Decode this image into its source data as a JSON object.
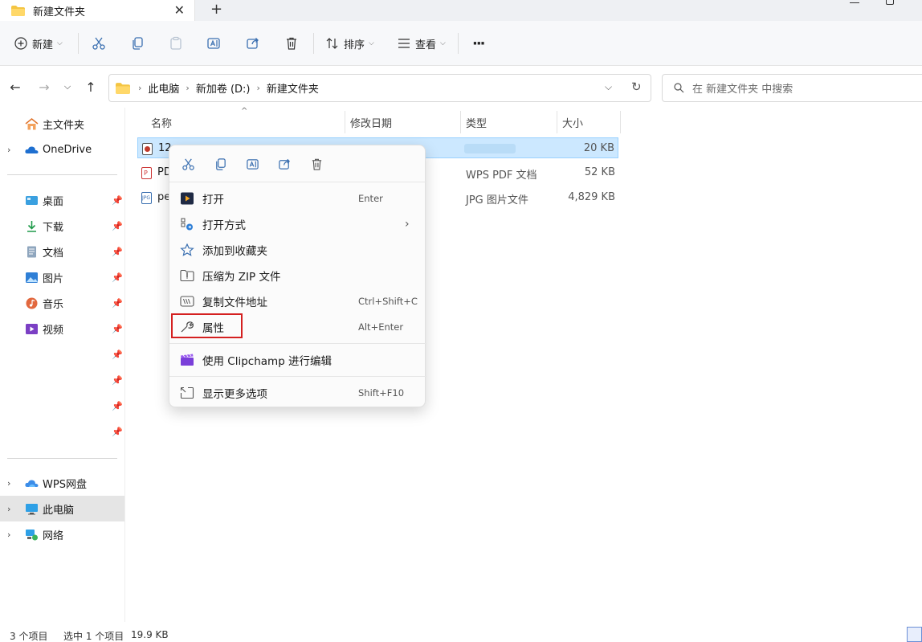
{
  "tab": {
    "title": "新建文件夹",
    "close_glyph": "✕",
    "new_glyph": "+"
  },
  "toolbar": {
    "new_label": "新建",
    "sort_label": "排序",
    "view_label": "查看",
    "more_glyph": "···"
  },
  "address": {
    "crumbs": [
      "此电脑",
      "新加卷 (D:)",
      "新建文件夹"
    ],
    "sep_glyph": "›"
  },
  "search": {
    "placeholder": "在 新建文件夹 中搜索"
  },
  "sidebar": {
    "home": "主文件夹",
    "onedrive": "OneDrive",
    "quick": [
      "桌面",
      "下载",
      "文档",
      "图片",
      "音乐",
      "视频"
    ],
    "wps": "WPS网盘",
    "pc": "此电脑",
    "network": "网络"
  },
  "columns": {
    "name": "名称",
    "modified": "修改日期",
    "type": "类型",
    "size": "大小"
  },
  "files": [
    {
      "name": "12",
      "type": "",
      "size": "20 KB"
    },
    {
      "name": "PD",
      "type": "WPS PDF 文档",
      "size": "52 KB"
    },
    {
      "name": "pe",
      "type": "JPG 图片文件",
      "size": "4,829 KB"
    }
  ],
  "context_menu": {
    "open": {
      "label": "打开",
      "key": "Enter"
    },
    "open_with": {
      "label": "打开方式"
    },
    "favorite": {
      "label": "添加到收藏夹"
    },
    "zip": {
      "label": "压缩为 ZIP 文件"
    },
    "copy_path": {
      "label": "复制文件地址",
      "key": "Ctrl+Shift+C"
    },
    "properties": {
      "label": "属性",
      "key": "Alt+Enter"
    },
    "clipchamp": {
      "label": "使用 Clipchamp 进行编辑"
    },
    "more": {
      "label": "显示更多选项",
      "key": "Shift+F10"
    }
  },
  "status": {
    "count": "3 个项目",
    "selected": "选中 1 个项目",
    "size": "19.9 KB"
  },
  "colors": {
    "selection": "#cce8ff",
    "highlight_border": "#d42020",
    "folder": "#f4c542"
  }
}
